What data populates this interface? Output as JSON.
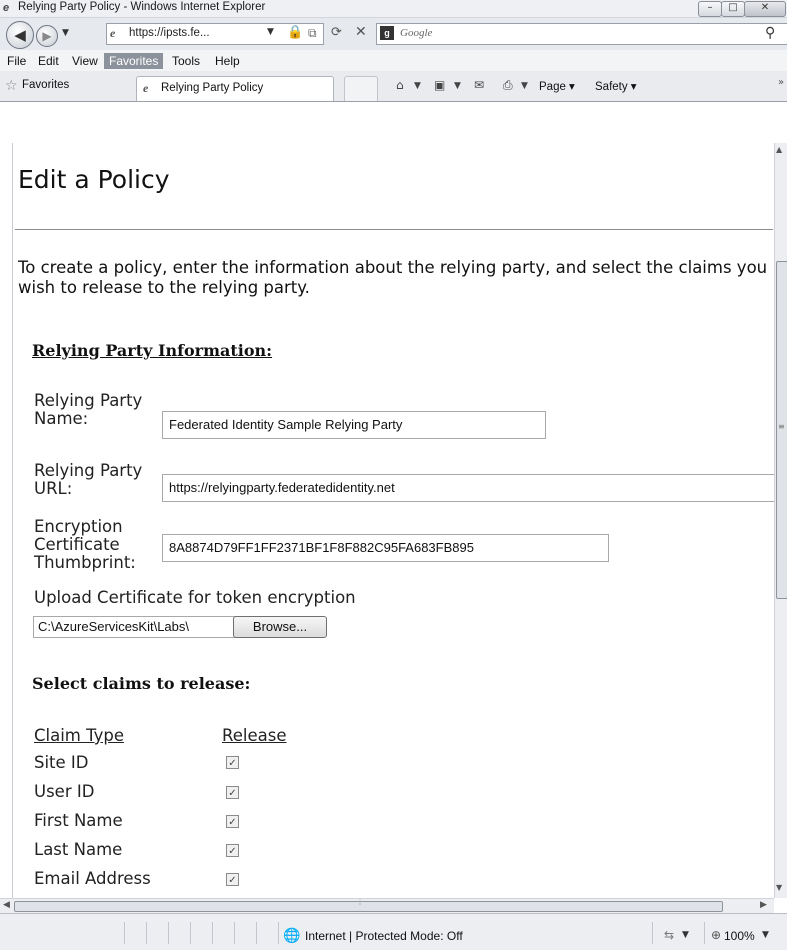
{
  "window": {
    "title": "Relying Party Policy - Windows Internet Explorer",
    "controls": {
      "minimize": "–",
      "maximize": "□",
      "close": "✕"
    }
  },
  "address": {
    "url": "https://ipsts.fe...",
    "search_placeholder": "Google"
  },
  "menu": [
    "File",
    "Edit",
    "View",
    "Favorites",
    "Tools",
    "Help"
  ],
  "tabbar": {
    "favorites_label": "Favorites",
    "tab_title": "Relying Party Policy",
    "page_label": "Page ▾",
    "safety_label": "Safety ▾"
  },
  "page": {
    "title": "Edit a Policy",
    "intro": "To create a policy, enter the information about the relying party, and select the claims you wish to release to the relying party.",
    "rp_section": "Relying Party Information:",
    "fields": {
      "name_label": "Relying Party Name:",
      "name_value": "Federated Identity Sample Relying Party",
      "url_label": "Relying Party URL:",
      "url_value": "https://relyingparty.federatedidentity.net",
      "thumb_label": "Encryption Certificate Thumbprint:",
      "thumb_value": "8A8874D79FF1FF2371BF1F8F882C95FA683FB895",
      "upload_label": "Upload Certificate for token encryption",
      "file_value": "C:\\AzureServicesKit\\Labs\\",
      "browse_label": "Browse..."
    },
    "claims_section": "Select claims to release:",
    "claims_columns": {
      "type": "Claim Type",
      "release": "Release"
    },
    "claims": [
      {
        "name": "Site ID",
        "released": true
      },
      {
        "name": "User ID",
        "released": true
      },
      {
        "name": "First Name",
        "released": true
      },
      {
        "name": "Last Name",
        "released": true
      },
      {
        "name": "Email Address",
        "released": true
      }
    ]
  },
  "status": {
    "zone": "Internet | Protected Mode: Off",
    "zoom": "100%"
  },
  "colors": {
    "menu_highlight": "#8c929c",
    "rule": "#8c8c8c"
  },
  "icons": [
    "ie-logo-icon",
    "back-icon",
    "forward-icon",
    "lock-icon",
    "refresh-icon",
    "stop-icon",
    "search-icon",
    "star-icon",
    "home-icon",
    "feeds-icon",
    "mail-icon",
    "print-icon",
    "globe-icon",
    "zoom-icon"
  ]
}
